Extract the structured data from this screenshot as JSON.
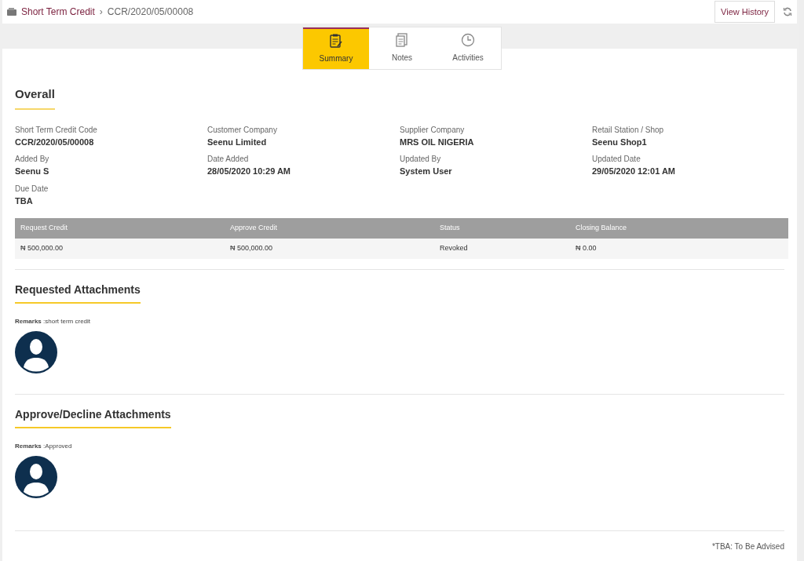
{
  "breadcrumb": {
    "parent": "Short Term Credit",
    "separator": "›",
    "current": "CCR/2020/05/00008"
  },
  "header_button": "View History",
  "tabs": [
    {
      "label": "Summary",
      "selected": true,
      "kind": "summary"
    },
    {
      "label": "Notes",
      "selected": false,
      "kind": "notes"
    },
    {
      "label": "Activities",
      "selected": false,
      "kind": "activities"
    }
  ],
  "overall": {
    "title": "Overall",
    "fields": [
      {
        "label": "Short Term Credit Code",
        "value": "CCR/2020/05/00008"
      },
      {
        "label": "Customer Company",
        "value": "Seenu Limited"
      },
      {
        "label": "Supplier Company",
        "value": "MRS OIL NIGERIA"
      },
      {
        "label": "Retail Station / Shop",
        "value": "Seenu Shop1"
      },
      {
        "label": "Added By",
        "value": "Seenu S"
      },
      {
        "label": "Date Added",
        "value": "28/05/2020 10:29 AM"
      },
      {
        "label": "Updated By",
        "value": "System User"
      },
      {
        "label": "Updated Date",
        "value": "29/05/2020 12:01 AM"
      },
      {
        "label": "Due Date",
        "value": "TBA"
      }
    ]
  },
  "table": {
    "columns": [
      "Request Credit",
      "Approve Credit",
      "Status",
      "Closing Balance"
    ],
    "rows": [
      [
        "₦ 500,000.00",
        "₦ 500,000.00",
        "Revoked",
        "₦ 0.00"
      ]
    ]
  },
  "attachments": [
    {
      "title": "Requested Attachments",
      "remarks": "**Remarks** :short term credit"
    },
    {
      "title": "Approve/Decline Attachments",
      "remarks": "**Remarks** :Approved"
    }
  ],
  "footnote": "*TBA: To Be Advised"
}
